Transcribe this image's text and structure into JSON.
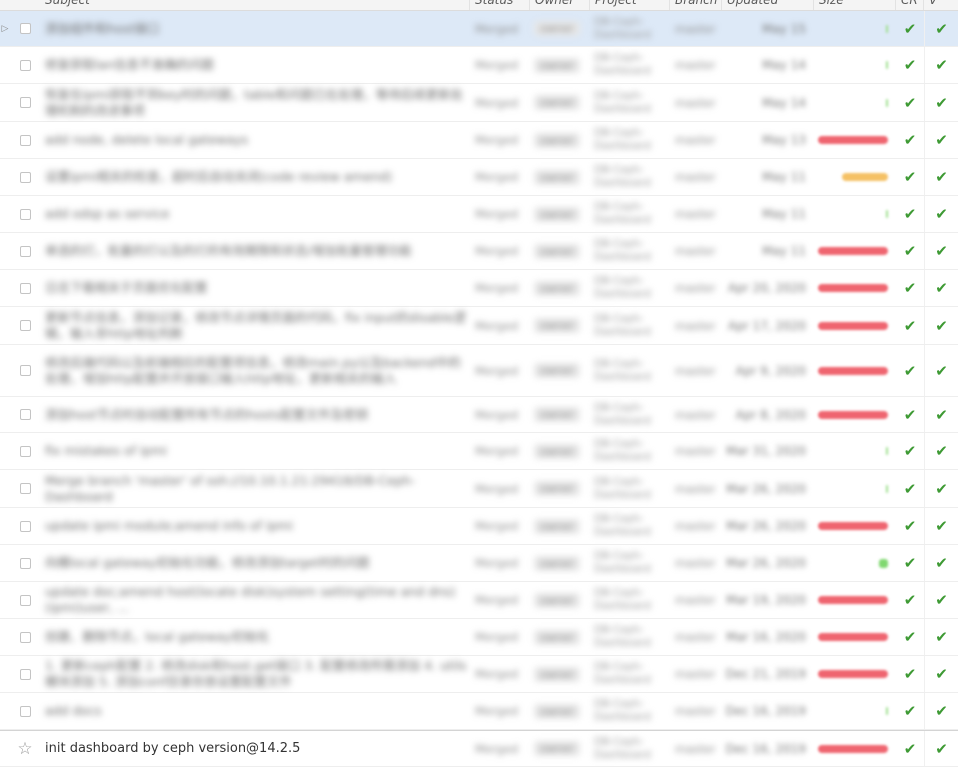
{
  "header": {
    "subject": "Subject",
    "status": "Status",
    "owner": "Owner",
    "project": "Project",
    "branch": "Branch",
    "updated": "Updated",
    "size": "Size",
    "cr": "CR",
    "v": "V"
  },
  "icons": {
    "row_arrow": "expand-arrow-icon",
    "checkbox": "checkbox-icon",
    "star": "star-icon",
    "check": "checkmark-icon"
  },
  "colors": {
    "selected_row": "#dde9f7",
    "size_large": "#ef6570",
    "size_medium": "#f5c164",
    "size_small": "#9fe08f",
    "check": "#3e9a34"
  },
  "rows": [
    {
      "subject": "添加组件和host接口",
      "status": "Merged",
      "owner": "owner",
      "project": "DB-Ceph-Dashboard",
      "branch": "master",
      "updated": "May 15",
      "size": "xs",
      "cr": "✔",
      "v": "✔"
    },
    {
      "subject": "修复获取lan信息不准确的问题",
      "status": "Merged",
      "owner": "owner",
      "project": "DB-Ceph-Dashboard",
      "branch": "master",
      "updated": "May 14",
      "size": "xs",
      "cr": "✔",
      "v": "✔"
    },
    {
      "subject": "恢复在ipmi获取不到key时的问题，table和问题已在处理，等待后续更新处理机制的改进事项",
      "status": "Merged",
      "owner": "owner",
      "project": "DB-Ceph-Dashboard",
      "branch": "master",
      "updated": "May 14",
      "size": "xs",
      "cr": "✔",
      "v": "✔"
    },
    {
      "subject": "add node, delete local gateways",
      "status": "Merged",
      "owner": "owner",
      "project": "DB-Ceph-Dashboard",
      "branch": "master",
      "updated": "May 13",
      "size": "l",
      "cr": "✔",
      "v": "✔"
    },
    {
      "subject": "设置ipmi相关的检查，超时后自动关闭(code review amend)",
      "status": "Merged",
      "owner": "owner",
      "project": "DB-Ceph-Dashboard",
      "branch": "master",
      "updated": "May 11",
      "size": "m",
      "cr": "✔",
      "v": "✔"
    },
    {
      "subject": "add odsp as service",
      "status": "Merged",
      "owner": "owner",
      "project": "DB-Ceph-Dashboard",
      "branch": "master",
      "updated": "May 11",
      "size": "xs",
      "cr": "✔",
      "v": "✔"
    },
    {
      "subject": "单选的灯，批量的灯以及的灯的有效期限和状态/增加批量管理功能",
      "status": "Merged",
      "owner": "owner",
      "project": "DB-Ceph-Dashboard",
      "branch": "master",
      "updated": "May 11",
      "size": "l",
      "cr": "✔",
      "v": "✔"
    },
    {
      "subject": "日志下载相关于页面优化配置",
      "status": "Merged",
      "owner": "owner",
      "project": "DB-Ceph-Dashboard",
      "branch": "master",
      "updated": "Apr 20, 2020",
      "size": "l",
      "cr": "✔",
      "v": "✔"
    },
    {
      "subject": "更新节点信息，添加记录，修改节点详情页面的代码，fix input的disable逻辑，输入非http地址判断",
      "status": "Merged",
      "owner": "owner",
      "project": "DB-Ceph-Dashboard",
      "branch": "master",
      "updated": "Apr 17, 2020",
      "size": "l",
      "cr": "✔",
      "v": "✔"
    },
    {
      "subject": "修改后端代码以及前端相应的配置项信息，修改main.py以及backend中的处理，增加http配置并开放接口输入http地址，更新相关的输入",
      "status": "Merged",
      "owner": "owner",
      "project": "DB-Ceph-Dashboard",
      "branch": "master",
      "updated": "Apr 9, 2020",
      "size": "l",
      "cr": "✔",
      "v": "✔"
    },
    {
      "subject": "添加host节点时自动配置所有节点的hosts配置文件及密钥",
      "status": "Merged",
      "owner": "owner",
      "project": "DB-Ceph-Dashboard",
      "branch": "master",
      "updated": "Apr 8, 2020",
      "size": "l",
      "cr": "✔",
      "v": "✔"
    },
    {
      "subject": "fix mistakes of ipmi",
      "status": "Merged",
      "owner": "owner",
      "project": "DB-Ceph-Dashboard",
      "branch": "master",
      "updated": "Mar 31, 2020",
      "size": "xs",
      "cr": "✔",
      "v": "✔"
    },
    {
      "subject": "Merge branch 'master' of ssh://10.10.1.21:29418/DB-Ceph-Dashboard",
      "status": "Merged",
      "owner": "owner",
      "project": "DB-Ceph-Dashboard",
      "branch": "master",
      "updated": "Mar 26, 2020",
      "size": "xs",
      "cr": "✔",
      "v": "✔"
    },
    {
      "subject": "update ipmi module;amend info of ipmi",
      "status": "Merged",
      "owner": "owner",
      "project": "DB-Ceph-Dashboard",
      "branch": "master",
      "updated": "Mar 26, 2020",
      "size": "l",
      "cr": "✔",
      "v": "✔"
    },
    {
      "subject": "向模local gateway初始化功能，修改添加target时的问题",
      "status": "Merged",
      "owner": "owner",
      "project": "DB-Ceph-Dashboard",
      "branch": "master",
      "updated": "Mar 26, 2020",
      "size": "g",
      "cr": "✔",
      "v": "✔"
    },
    {
      "subject": "update doc;amend host(locate disk)system setting(time and dns)(ipmi)user, ...",
      "status": "Merged",
      "owner": "owner",
      "project": "DB-Ceph-Dashboard",
      "branch": "master",
      "updated": "Mar 19, 2020",
      "size": "l",
      "cr": "✔",
      "v": "✔"
    },
    {
      "subject": "创建、删除节点，local gateway初始化",
      "status": "Merged",
      "owner": "owner",
      "project": "DB-Ceph-Dashboard",
      "branch": "master",
      "updated": "Mar 16, 2020",
      "size": "l",
      "cr": "✔",
      "v": "✔"
    },
    {
      "subject": "1. 更新ceph配置 2. 修改disk和host.get接口 3. 配置修改所需添加  4. utils模块添加  5. 添加conf目录存放设置配置文件",
      "status": "Merged",
      "owner": "owner",
      "project": "DB-Ceph-Dashboard",
      "branch": "master",
      "updated": "Dec 21, 2019",
      "size": "l",
      "cr": "✔",
      "v": "✔"
    },
    {
      "subject": "add docs",
      "status": "Merged",
      "owner": "owner",
      "project": "DB-Ceph-Dashboard",
      "branch": "master",
      "updated": "Dec 16, 2019",
      "size": "xs",
      "cr": "✔",
      "v": "✔"
    },
    {
      "subject": "init dashboard by ceph version@14.2.5",
      "status": "Merged",
      "owner": "owner",
      "project": "DB-Ceph-Dashboard",
      "branch": "master",
      "updated": "Dec 16, 2019",
      "size": "l",
      "cr": "✔",
      "v": "✔"
    }
  ]
}
